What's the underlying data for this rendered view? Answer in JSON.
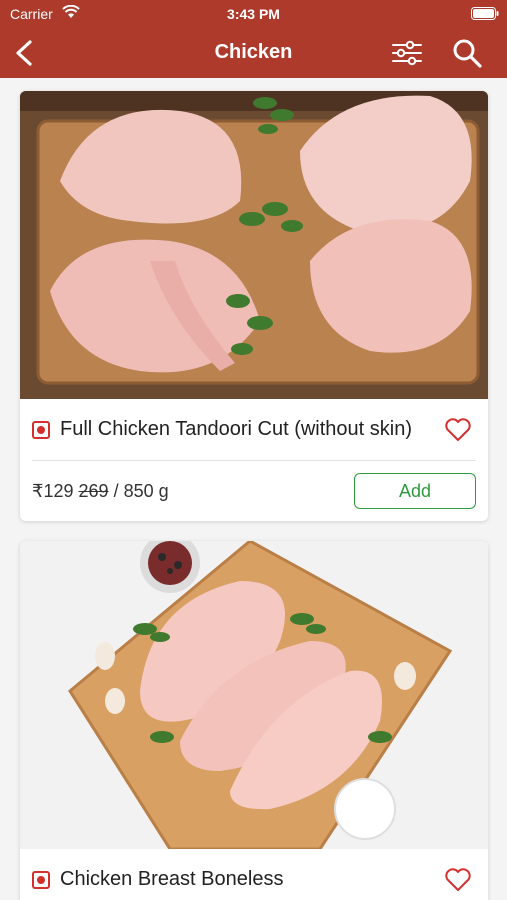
{
  "status_bar": {
    "carrier": "Carrier",
    "time": "3:43 PM"
  },
  "nav": {
    "title": "Chicken"
  },
  "products": [
    {
      "name": "Full Chicken Tandoori Cut (without skin)",
      "price": "₹129",
      "original_price": "269",
      "weight": "/ 850 g",
      "add_label": "Add"
    },
    {
      "name": "Chicken Breast Boneless"
    }
  ],
  "colors": {
    "header": "#ae3a2c",
    "add_green": "#2e9b3e",
    "nonveg_red": "#d32f2f"
  }
}
